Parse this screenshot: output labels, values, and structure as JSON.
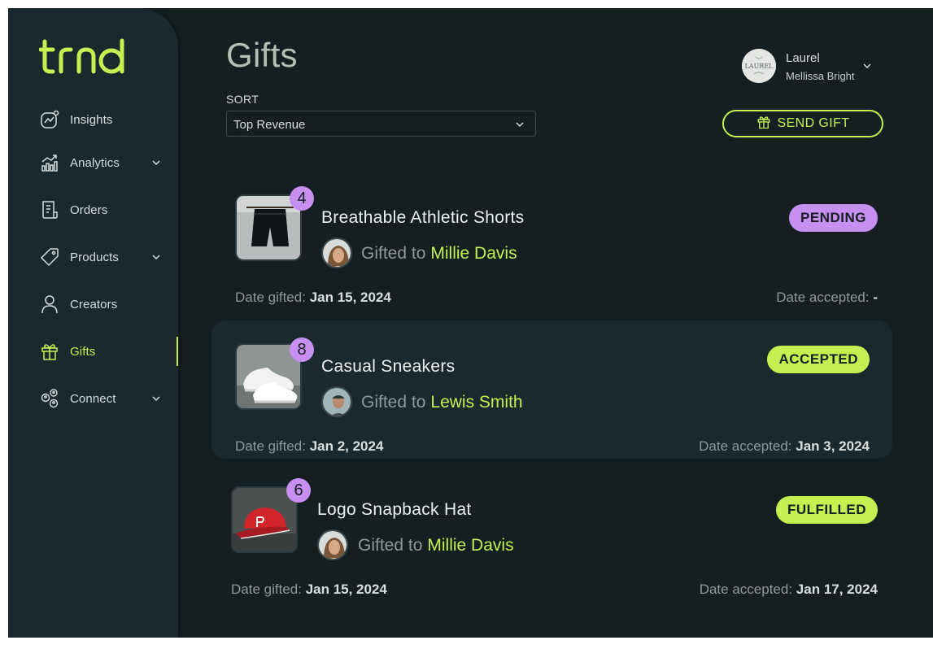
{
  "brand": {
    "logo_text": "trnd",
    "accent": "#c6f052",
    "purple": "#c78ff0"
  },
  "nav": [
    {
      "label": "Insights",
      "icon": "insights-icon",
      "has_chevron": false
    },
    {
      "label": "Analytics",
      "icon": "analytics-icon",
      "has_chevron": true
    },
    {
      "label": "Orders",
      "icon": "orders-icon",
      "has_chevron": false
    },
    {
      "label": "Products",
      "icon": "tag-icon",
      "has_chevron": true
    },
    {
      "label": "Creators",
      "icon": "user-icon",
      "has_chevron": false
    },
    {
      "label": "Gifts",
      "icon": "gift-icon",
      "has_chevron": false,
      "active": true
    },
    {
      "label": "Connect",
      "icon": "connect-icon",
      "has_chevron": true
    }
  ],
  "header": {
    "title": "Gifts",
    "sort_label": "SORT",
    "sort_value": "Top Revenue",
    "send_gift_label": "SEND GIFT"
  },
  "user": {
    "name": "Laurel",
    "subtitle": "Mellissa Bright",
    "avatar_text": "LAUREL"
  },
  "gifts": [
    {
      "title": "Breathable Athletic Shorts",
      "count": "4",
      "gifted_prefix": "Gifted to",
      "recipient": "Millie Davis",
      "status": "PENDING",
      "status_color": "#c78ff0",
      "date_gifted_label": "Date gifted:",
      "date_gifted": "Jan 15, 2024",
      "date_accepted_label": "Date accepted:",
      "date_accepted": "-"
    },
    {
      "title": "Casual Sneakers",
      "count": "8",
      "gifted_prefix": "Gifted to",
      "recipient": "Lewis Smith",
      "status": "ACCEPTED",
      "status_color": "#c6f052",
      "date_gifted_label": "Date gifted:",
      "date_gifted": "Jan 2, 2024",
      "date_accepted_label": "Date accepted:",
      "date_accepted": "Jan 3, 2024"
    },
    {
      "title": "Logo Snapback Hat",
      "count": "6",
      "gifted_prefix": "Gifted to",
      "recipient": "Millie Davis",
      "status": "FULFILLED",
      "status_color": "#c6f052",
      "date_gifted_label": "Date gifted:",
      "date_gifted": "Jan 15, 2024",
      "date_accepted_label": "Date accepted:",
      "date_accepted": "Jan 17, 2024"
    }
  ]
}
